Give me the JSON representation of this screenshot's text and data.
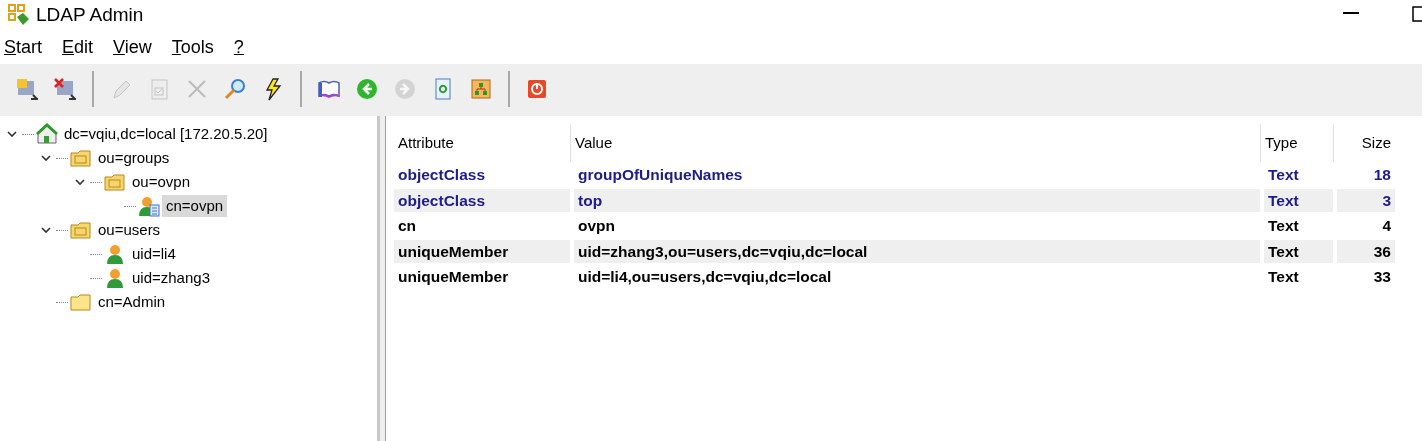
{
  "window": {
    "title": "LDAP Admin"
  },
  "menu": [
    {
      "label": "Start"
    },
    {
      "label": "Edit"
    },
    {
      "label": "View"
    },
    {
      "label": "Tools"
    },
    {
      "label": "?"
    }
  ],
  "toolbar": [
    [
      {
        "disabled": false
      },
      {
        "disabled": false
      }
    ],
    [
      {
        "disabled": true
      },
      {
        "disabled": true
      },
      {
        "disabled": true
      },
      {
        "disabled": false
      },
      {
        "disabled": false
      }
    ],
    [
      {
        "disabled": false
      },
      {
        "disabled": false
      },
      {
        "disabled": true
      },
      {
        "disabled": false
      },
      {
        "disabled": false
      }
    ],
    [
      {
        "disabled": false
      }
    ]
  ],
  "tree": [
    {
      "label": "dc=vqiu,dc=local [172.20.5.20]",
      "kind": "server",
      "expanded": true,
      "selected": false,
      "children": [
        {
          "label": "ou=groups",
          "kind": "folder",
          "expanded": true,
          "selected": false,
          "children": [
            {
              "label": "ou=ovpn",
              "kind": "folder",
              "expanded": true,
              "selected": false,
              "children": [
                {
                  "label": "cn=ovpn",
                  "kind": "group",
                  "selected": true
                }
              ]
            }
          ]
        },
        {
          "label": "ou=users",
          "kind": "folder",
          "expanded": true,
          "selected": false,
          "children": [
            {
              "label": "uid=li4",
              "kind": "user",
              "selected": false
            },
            {
              "label": "uid=zhang3",
              "kind": "user",
              "selected": false
            }
          ]
        },
        {
          "label": "cn=Admin",
          "kind": "leaf-folder",
          "selected": false
        }
      ]
    }
  ],
  "table": {
    "columns": [
      "Attribute",
      "Value",
      "Type",
      "Size"
    ],
    "rows": [
      {
        "kind": "objectclass",
        "cells": [
          "objectClass",
          "groupOfUniqueNames",
          "Text",
          "18"
        ]
      },
      {
        "kind": "objectclass",
        "cells": [
          "objectClass",
          "top",
          "Text",
          "3"
        ]
      },
      {
        "kind": "attribute",
        "cells": [
          "cn",
          "ovpn",
          "Text",
          "4"
        ]
      },
      {
        "kind": "attribute",
        "cells": [
          "uniqueMember",
          "uid=zhang3,ou=users,dc=vqiu,dc=local",
          "Text",
          "36"
        ]
      },
      {
        "kind": "attribute",
        "cells": [
          "uniqueMember",
          "uid=li4,ou=users,dc=vqiu,dc=local",
          "Text",
          "33"
        ]
      }
    ]
  }
}
